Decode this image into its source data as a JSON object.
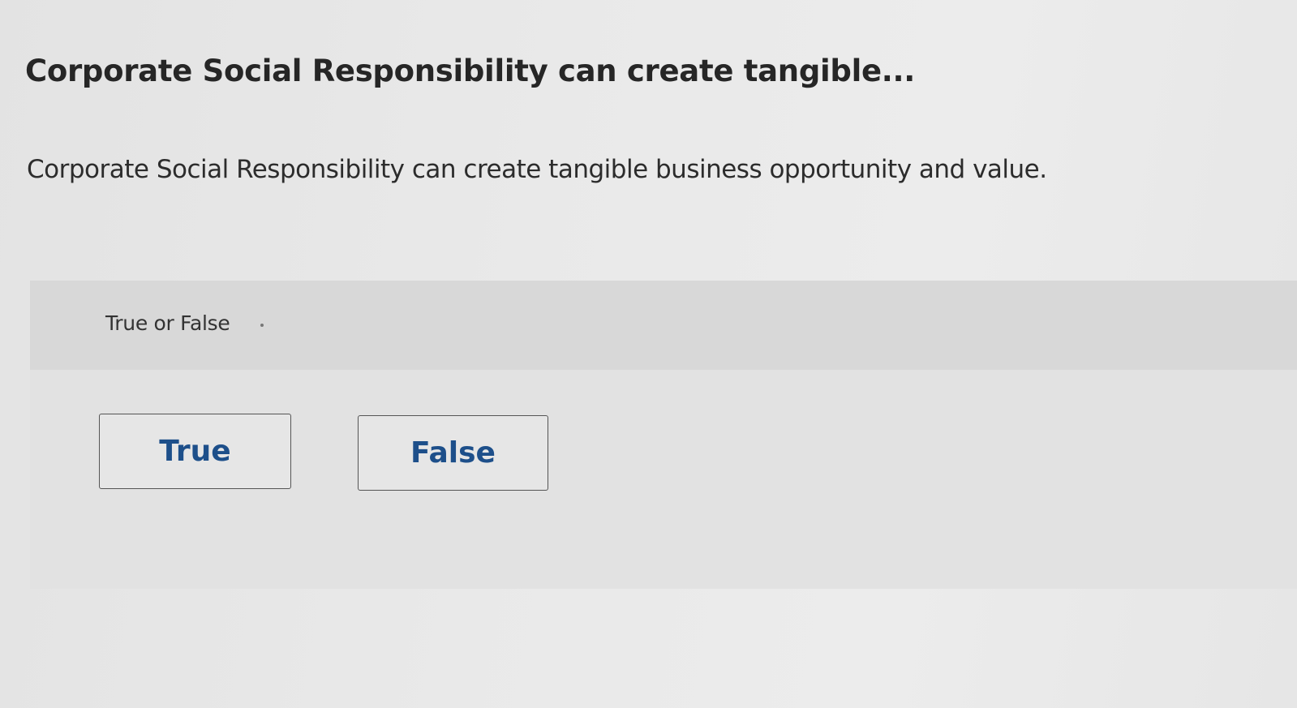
{
  "question": {
    "title": "Corporate Social Responsibility can create tangible...",
    "text": "Corporate Social Responsibility can create tangible business opportunity and value."
  },
  "answer_panel": {
    "question_type": "True or False",
    "choices": [
      {
        "label": "True"
      },
      {
        "label": "False"
      }
    ]
  },
  "colors": {
    "choice_text": "#1d4f8a",
    "panel_header": "#d8d8d8",
    "panel_body": "#e2e2e2"
  }
}
